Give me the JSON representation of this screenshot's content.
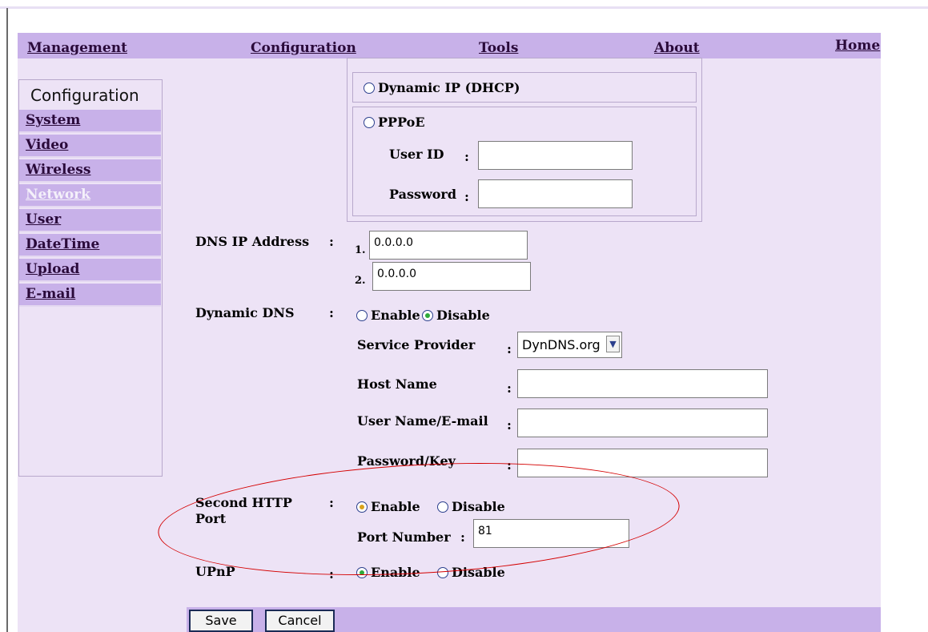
{
  "menu": {
    "management": "Management",
    "configuration": "Configuration",
    "tools": "Tools",
    "about": "About",
    "home": "Home"
  },
  "sidebar": {
    "title": "Configuration",
    "items": [
      {
        "label": "System"
      },
      {
        "label": "Video"
      },
      {
        "label": "Wireless"
      },
      {
        "label": "Network",
        "active": true
      },
      {
        "label": "User"
      },
      {
        "label": "DateTime"
      },
      {
        "label": "Upload"
      },
      {
        "label": "E-mail"
      }
    ]
  },
  "ip_mode": {
    "dhcp_label": "Dynamic IP (DHCP)",
    "pppoe_label": "PPPoE",
    "user_id_label": "User ID",
    "password_label": "Password",
    "user_id_value": "",
    "password_value": ""
  },
  "dns": {
    "label": "DNS IP Address",
    "dns1_prefix": "1.",
    "dns1_value": "0.0.0.0",
    "dns2_prefix": "2.",
    "dns2_value": "0.0.0.0"
  },
  "ddns": {
    "label": "Dynamic DNS",
    "enable_label": "Enable",
    "disable_label": "Disable",
    "selected": "Disable",
    "provider_label": "Service Provider",
    "provider_value": "DynDNS.org",
    "host_label": "Host Name",
    "host_value": "",
    "user_label": "User Name/E-mail",
    "user_value": "",
    "pass_label": "Password/Key",
    "pass_value": ""
  },
  "second_http": {
    "label": "Second HTTP Port",
    "enable_label": "Enable",
    "disable_label": "Disable",
    "selected": "Enable",
    "port_label": "Port Number",
    "port_value": "81"
  },
  "upnp": {
    "label": "UPnP",
    "enable_label": "Enable",
    "disable_label": "Disable",
    "selected": "Enable"
  },
  "buttons": {
    "save": "Save",
    "cancel": "Cancel"
  },
  "colors": {
    "menu_bar": "#c8b1e9",
    "panel": "#ede3f6",
    "annotation": "#d40000"
  }
}
